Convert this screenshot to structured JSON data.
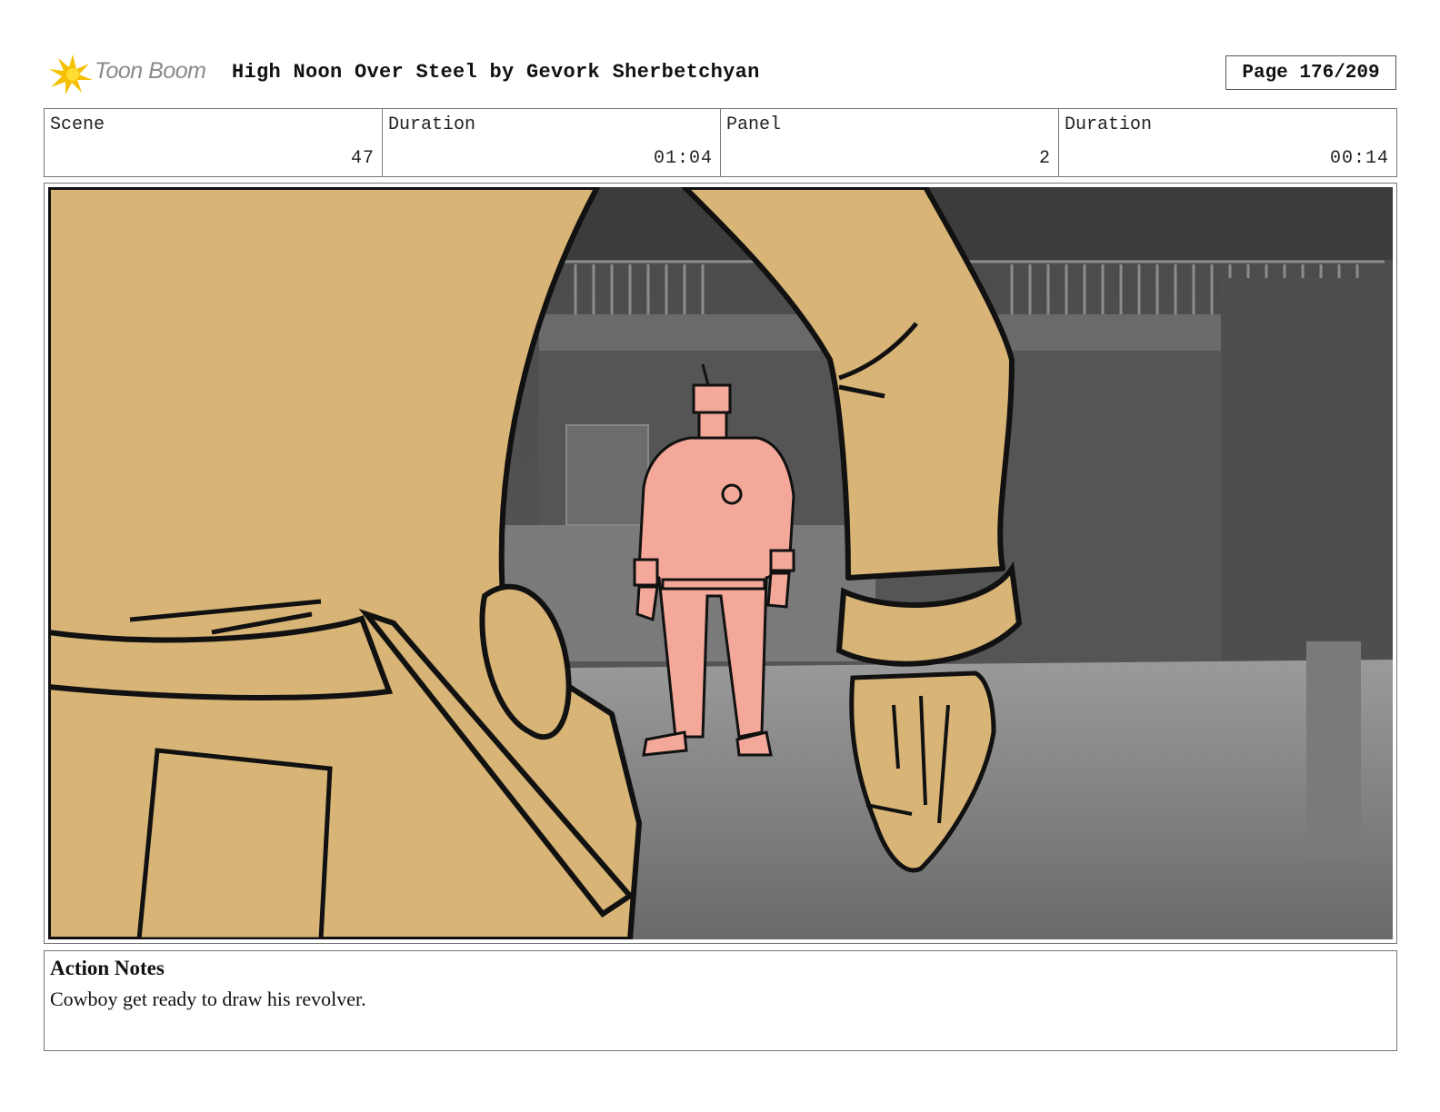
{
  "header": {
    "logo_text": "Toon Boom",
    "title": "High Noon Over Steel by Gevork Sherbetchyan",
    "page": "Page 176/209"
  },
  "info": {
    "scene_label": "Scene",
    "scene_value": "47",
    "scene_duration_label": "Duration",
    "scene_duration_value": "01:04",
    "panel_label": "Panel",
    "panel_value": "2",
    "panel_duration_label": "Duration",
    "panel_duration_value": "00:14"
  },
  "notes": {
    "heading": "Action Notes",
    "text": "Cowboy get ready to draw his revolver."
  },
  "colors": {
    "skin": "#d8b476",
    "robot": "#f4a89a",
    "background": "#6e6e6e",
    "logo_accent": "#f5c000"
  }
}
